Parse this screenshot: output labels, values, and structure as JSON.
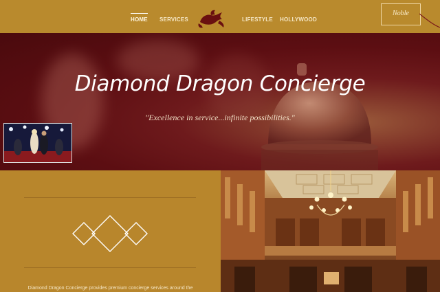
{
  "nav": {
    "items": [
      {
        "label": "Home",
        "active": true
      },
      {
        "label": "Services",
        "active": false
      },
      {
        "label": "Lifestyle",
        "active": false
      },
      {
        "label": "Hollywood",
        "active": false
      }
    ],
    "logo_icon": "dragon-logo-icon",
    "signature_text": "Noble"
  },
  "hero": {
    "title": "Diamond Dragon Concierge",
    "tagline": "\"Excellence in service...infinite possibilities.\""
  },
  "intro": {
    "text": "Diamond Dragon Concierge provides premium concierge services around the"
  },
  "colors": {
    "gold": "#b8862c",
    "maroon": "#5c0e12",
    "cream": "#f5e6c4"
  }
}
